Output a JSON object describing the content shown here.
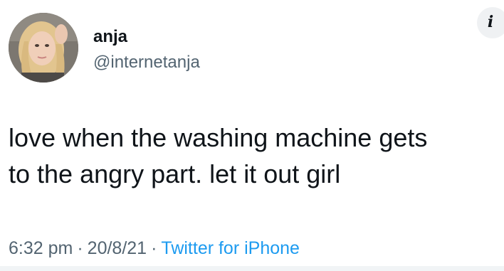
{
  "tweet": {
    "user": {
      "name": "anja",
      "handle": "@internetanja",
      "avatar_icon": "profile-photo"
    },
    "info_icon": "info-icon",
    "text_lines": [
      "love when the washing machine gets",
      "to the angry part. let it out girl"
    ],
    "meta": {
      "time": "6:32 pm",
      "separator": "·",
      "date": "20/8/21",
      "source": "Twitter for iPhone"
    }
  },
  "colors": {
    "text": "#0f1419",
    "secondary": "#536471",
    "link": "#1d9bf0",
    "background": "#ffffff"
  }
}
